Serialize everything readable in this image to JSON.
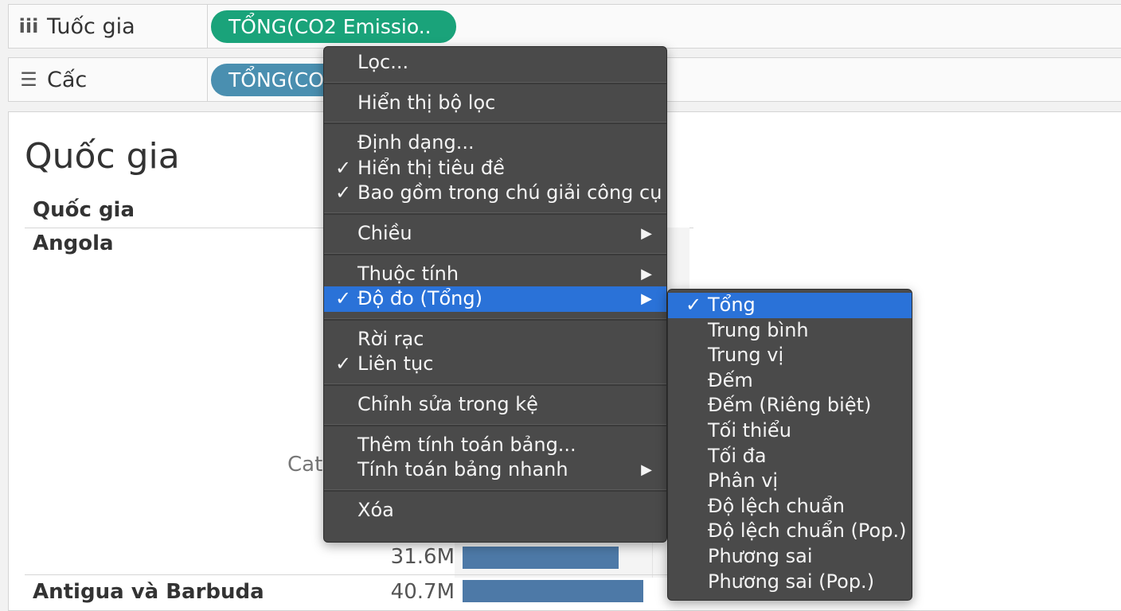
{
  "columns_shelf": {
    "label": "Tuốc gia",
    "icon": "columns-icon",
    "pill": "TỔNG(CO2 Emissio.."
  },
  "rows_shelf": {
    "label": "Cấc",
    "icon": "rows-icon",
    "pill": "TỔNG(CO"
  },
  "view": {
    "title": "Quốc gia",
    "column_header": "Quốc gia",
    "partial_label": "Cat",
    "rows": [
      {
        "name": "Angola",
        "value_label": "31.6M",
        "value": 31.6
      },
      {
        "name": "Antigua và Barbuda",
        "value_label": "40.7M",
        "value": 40.7
      }
    ]
  },
  "context_menu": {
    "filter": "Lọc...",
    "show_filter": "Hiển thị bộ lọc",
    "format": "Định dạng...",
    "show_header": "Hiển thị tiêu đề",
    "include_in_tooltip": "Bao gồm trong chú giải công cụ",
    "dimension": "Chiều",
    "attribute": "Thuộc tính",
    "measure": "Độ đo (Tổng)",
    "discrete": "Rời rạc",
    "continuous": "Liên tục",
    "edit_in_shelf": "Chỉnh sửa trong kệ",
    "add_table_calc": "Thêm tính toán bảng...",
    "quick_table_calc": "Tính toán bảng nhanh",
    "remove": "Xóa",
    "check_glyph": "✓",
    "arrow_glyph": "▶"
  },
  "measure_submenu": {
    "selected_index": 0,
    "items": [
      "Tổng",
      "Trung bình",
      "Trung vị",
      "Đếm",
      "Đếm (Riêng biệt)",
      "Tối thiểu",
      "Tối đa",
      "Phân vị",
      "Độ lệch chuẩn",
      "Độ lệch chuẩn (Pop.)",
      "Phương sai",
      "Phương sai (Pop.)"
    ]
  },
  "colors": {
    "menu_bg": "#4a4a4a",
    "highlight": "#2a72d8",
    "pill_green": "#1aa37a",
    "pill_blue": "#4a8fb0",
    "bar": "#4d79a7"
  }
}
